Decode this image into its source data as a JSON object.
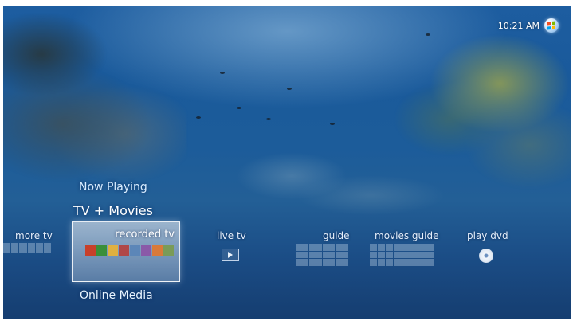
{
  "status": {
    "time": "10:21 AM"
  },
  "icons": {
    "windows_logo": "windows-logo-icon",
    "live_tv": "play-icon",
    "guide": "grid-icon",
    "movies_guide": "grid-icon",
    "play_dvd": "disc-icon"
  },
  "menu": {
    "now_playing": "Now Playing",
    "category": "TV + Movies",
    "online_media": "Online Media",
    "items": [
      {
        "label": "more tv"
      },
      {
        "label": "recorded tv",
        "selected": true
      },
      {
        "label": "live tv"
      },
      {
        "label": "guide"
      },
      {
        "label": "movies guide"
      },
      {
        "label": "play dvd"
      }
    ]
  },
  "thumbnails": [
    "#c8402b",
    "#3a8f3a",
    "#e0b040",
    "#b04848",
    "#5c86b8",
    "#8a5aa8",
    "#d97a3a",
    "#7a9b58"
  ],
  "colors": {
    "accent": "#ffffff",
    "background": "#1c5c9a"
  }
}
